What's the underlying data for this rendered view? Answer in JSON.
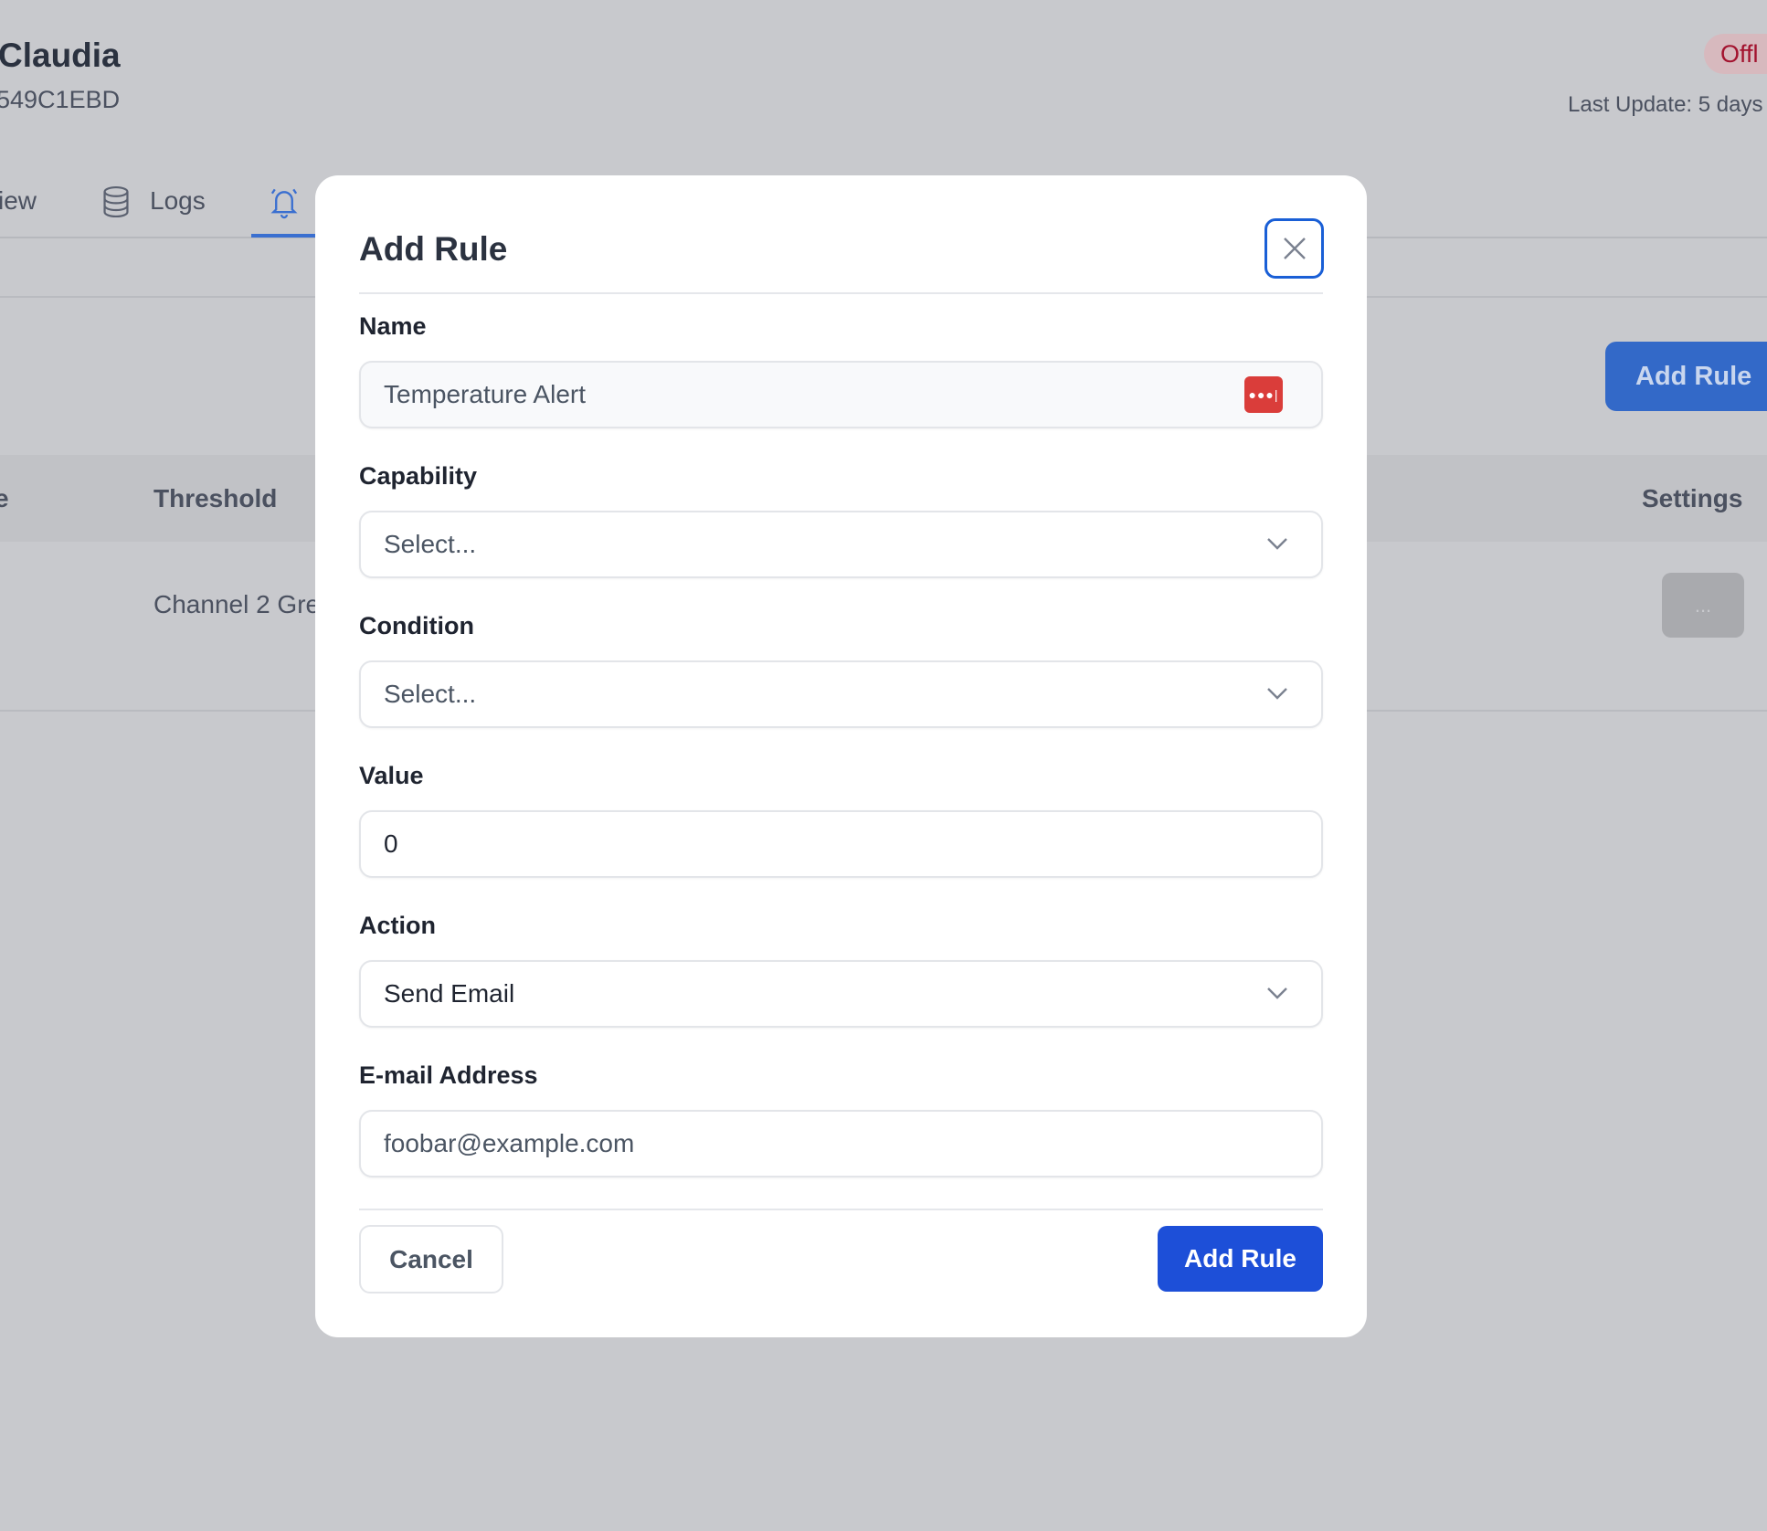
{
  "background": {
    "device_name": "Claudia",
    "device_id": "549C1EBD",
    "status_badge": "Offl",
    "last_update": "Last Update: 5 days",
    "tabs": [
      {
        "label": "iew",
        "icon": "none"
      },
      {
        "label": "Logs",
        "icon": "database-icon"
      },
      {
        "label": "",
        "icon": "bell-icon",
        "active": true
      }
    ],
    "add_rule_button": "Add Rule",
    "table": {
      "headers": [
        "e",
        "Threshold",
        "Settings"
      ],
      "rows": [
        {
          "threshold": "Channel 2 Gre",
          "settings": "..."
        }
      ]
    }
  },
  "modal": {
    "title": "Add Rule",
    "fields": {
      "name": {
        "label": "Name",
        "value": "Temperature Alert"
      },
      "capability": {
        "label": "Capability",
        "value": "Select..."
      },
      "condition": {
        "label": "Condition",
        "value": "Select..."
      },
      "value": {
        "label": "Value",
        "value": "0"
      },
      "action": {
        "label": "Action",
        "value": "Send Email"
      },
      "email": {
        "label": "E-mail Address",
        "placeholder": "foobar@example.com"
      }
    },
    "cancel_label": "Cancel",
    "submit_label": "Add Rule"
  },
  "colors": {
    "accent": "#1d4fd8",
    "password_manager": "#da3d3a",
    "overlay": "#c8c9cd"
  }
}
